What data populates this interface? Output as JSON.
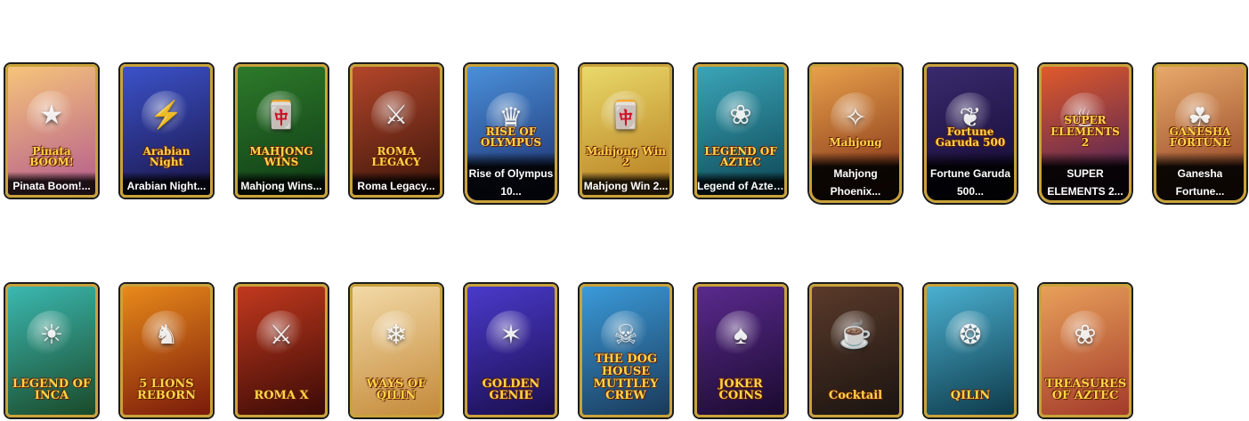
{
  "games_row1": [
    {
      "title": "Pinata Boom!...",
      "logo": "Pinata BOOM!",
      "icon": "star-icon",
      "c1": "#f6c47a",
      "c2": "#b35a8e"
    },
    {
      "title": "Arabian Night...",
      "logo": "Arabian Night",
      "icon": "lightning-icon",
      "c1": "#3b52c9",
      "c2": "#1a1446"
    },
    {
      "title": "Mahjong Wins...",
      "logo": "MAHJONG WINS",
      "icon": "mahjong-tile-icon",
      "c1": "#2d7a2a",
      "c2": "#0f3a16"
    },
    {
      "title": "Roma Legacy...",
      "logo": "ROMA LEGACY",
      "icon": "helmet-icon",
      "c1": "#b3462a",
      "c2": "#3a140a"
    },
    {
      "title_lines": [
        "Rise of Olympus",
        "10..."
      ],
      "logo": "RISE OF OLYMPUS",
      "icon": "crown-icon",
      "c1": "#4a90d9",
      "c2": "#1b2d6b"
    },
    {
      "title": "Mahjong Win 2...",
      "logo": "Mahjong Win 2",
      "icon": "mahjong-tile-icon",
      "c1": "#e9d96a",
      "c2": "#b67b1e"
    },
    {
      "title": "Legend of Aztec...",
      "logo": "LEGEND OF AZTEC",
      "icon": "feather-icon",
      "c1": "#3aa5b8",
      "c2": "#0d4654"
    },
    {
      "title_lines": [
        "Mahjong",
        "Phoenix..."
      ],
      "logo": "Mahjong",
      "icon": "phoenix-icon",
      "c1": "#e8a04a",
      "c2": "#7a2a14"
    },
    {
      "title_lines": [
        "Fortune Garuda",
        "500..."
      ],
      "logo": "Fortune Garuda 500",
      "icon": "eagle-icon",
      "c1": "#3a2a6e",
      "c2": "#12082e"
    },
    {
      "title_lines": [
        "SUPER",
        "ELEMENTS 2..."
      ],
      "logo": "SUPER ELEMENTS 2",
      "icon": "flame-icon",
      "c1": "#e05a2a",
      "c2": "#3a1a5e"
    },
    {
      "title_lines": [
        "Ganesha",
        "Fortune..."
      ],
      "logo": "GANESHA FORTUNE",
      "icon": "elephant-icon",
      "c1": "#e8a96a",
      "c2": "#8a3a1e"
    }
  ],
  "games_row2": [
    {
      "logo": "LEGEND OF INCA",
      "icon": "mask-icon",
      "c1": "#3bb8b0",
      "c2": "#1a4a2a"
    },
    {
      "logo": "5 LIONS REBORN",
      "icon": "lion-icon",
      "c1": "#e88a1a",
      "c2": "#7a1a0a"
    },
    {
      "logo": "ROMA X",
      "icon": "helmet-icon",
      "c1": "#c2391e",
      "c2": "#3a0a06"
    },
    {
      "logo": "WAYS OF QILIN",
      "icon": "qilin-icon",
      "c1": "#f2d9a6",
      "c2": "#c48a3a"
    },
    {
      "logo": "GOLDEN GENIE",
      "icon": "genie-icon",
      "c1": "#4a3acb",
      "c2": "#1a0e4e"
    },
    {
      "logo": "THE DOG HOUSE MUTTLEY CREW",
      "icon": "skull-icon",
      "c1": "#3a9ad9",
      "c2": "#1a3a5a"
    },
    {
      "logo": "JOKER COINS",
      "icon": "joker-icon",
      "c1": "#5a2a8e",
      "c2": "#1a0a2e"
    },
    {
      "logo": "Cocktail",
      "icon": "cocktail-icon",
      "c1": "#5a3a2a",
      "c2": "#1a1410"
    },
    {
      "logo": "QILIN",
      "icon": "dragon-icon",
      "c1": "#4ab0d0",
      "c2": "#0e3a4a"
    },
    {
      "logo": "TREASURES OF AZTEC",
      "icon": "feather-icon",
      "c1": "#e8a05a",
      "c2": "#a33a2a"
    }
  ]
}
